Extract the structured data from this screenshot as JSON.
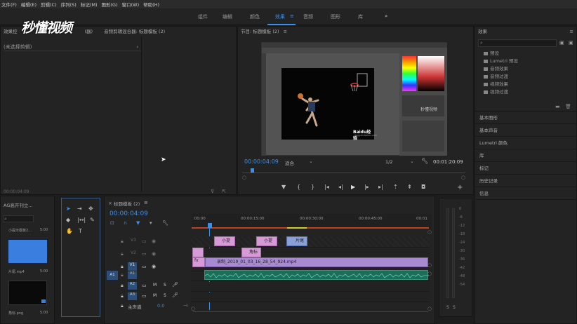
{
  "menu": [
    "文件(F)",
    "编辑(E)",
    "剪辑(C)",
    "序列(S)",
    "标记(M)",
    "图形(G)",
    "窗口(W)",
    "帮助(H)"
  ],
  "workspaces": [
    {
      "label": "组件",
      "active": false
    },
    {
      "label": "编辑",
      "active": false
    },
    {
      "label": "颜色",
      "active": false
    },
    {
      "label": "效果",
      "active": true
    },
    {
      "label": "音频",
      "active": false
    },
    {
      "label": "图形",
      "active": false
    },
    {
      "label": "库",
      "active": false
    }
  ],
  "workspace_more": "»",
  "watermark": "秒懂视频",
  "source_panel": {
    "tab1": "效果控",
    "tab1_suffix": "(器)",
    "tab2": "音频剪辑混合器: 标题模板 (2)",
    "no_clip": "(未选择剪辑)",
    "timecode": "00:00:04:09"
  },
  "program": {
    "title": "节目: 标题模板 (2)",
    "timecode": "00:00:04:09",
    "fit": "适合",
    "scale": "1/2",
    "duration": "00:01:20:09",
    "baidu": "Baidu经验",
    "baidu_sub": "jingyan.baidu.com",
    "overlay_text": "秒懂视频"
  },
  "project": {
    "title": "AG高开刊立...",
    "items": [
      {
        "name": "小提示模板2...",
        "dur": "5:00",
        "color": "#3a7ee0"
      },
      {
        "name": "片尾.mp4",
        "dur": "5:00",
        "color": "#0a0a0a"
      },
      {
        "name": "角标.png",
        "dur": "5:00",
        "color": "#0a0a0a"
      }
    ]
  },
  "timeline": {
    "title": "标题模板 (2)",
    "timecode": "00:00:04:09",
    "ruler": [
      ":00:00",
      "00:00:15:00",
      "00:00:30:00",
      "00:00:45:00",
      "00:01"
    ],
    "tracks": [
      "V3",
      "V2",
      "V1",
      "A1",
      "A2",
      "A3"
    ],
    "master": "主声道",
    "master_val": "0.0",
    "clips": {
      "tip1": "小提",
      "tip2": "小提",
      "end": "片尾",
      "corner": "角标",
      "main": "录制_2019_01_03_16_28_54_924.mp4",
      "fx": "fx"
    }
  },
  "effects": {
    "title": "效果",
    "tree": [
      "预设",
      "Lumetri 预设",
      "音频效果",
      "音频过渡",
      "视频效果",
      "视频过渡"
    ],
    "sections": [
      "基本图形",
      "基本声音",
      "Lumetri 颜色",
      "库",
      "标记",
      "历史记录",
      "信息"
    ]
  },
  "meter": {
    "ticks": [
      "0",
      "-6",
      "-12",
      "-18",
      "-24",
      "-30",
      "-36",
      "-42",
      "-48",
      "-54"
    ],
    "solo": [
      "S",
      "S"
    ]
  },
  "colors": {
    "accent": "#3b8fe8",
    "pink": "#d69ad6",
    "purple": "#a88ad0",
    "green": "#1d6d5b"
  }
}
